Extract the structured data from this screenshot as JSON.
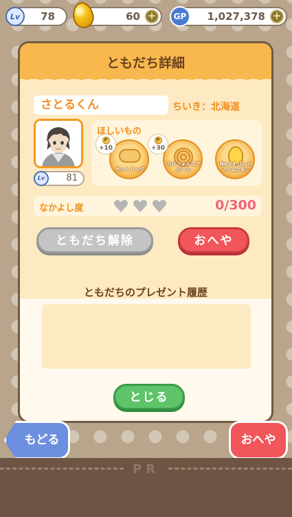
{
  "status_bar": {
    "level": "78",
    "eggs": "60",
    "gp": "1,027,378",
    "level_icon_text": "Lv",
    "gp_icon_text": "GP"
  },
  "panel": {
    "title": "ともだち詳細",
    "friend_name": "さとるくん",
    "region": "ちいき：北海道",
    "friend_level": "81",
    "wishlist": {
      "title": "ほしいもの",
      "items": [
        {
          "label": "ホットドッグ",
          "bonus": "+10",
          "icon": "hotdog-icon"
        },
        {
          "label": "カリフォルニアロール",
          "bonus": "+30",
          "icon": "california-roll-icon"
        },
        {
          "label": "No.34 パントマイムたまご",
          "icon": "egg-character-icon"
        }
      ]
    },
    "friendship": {
      "label": "なかよし度",
      "count": "0/300",
      "hearts_filled": 0,
      "hearts_total": 3
    },
    "unfriend_button": "ともだち解除",
    "room_button": "おへや",
    "history_title": "ともだちのプレゼント履歴",
    "history_items": [],
    "close_button": "とじる"
  },
  "bottom": {
    "back_button": "もどる",
    "room_button": "おへや",
    "ad_label": "PR"
  },
  "colors": {
    "accent_orange": "#f8b84e",
    "text_orange": "#f08f1e",
    "red_button": "#f0565a",
    "green_button": "#5ec46a",
    "blue_button": "#6c8fdf",
    "pink_count": "#f0637a"
  }
}
